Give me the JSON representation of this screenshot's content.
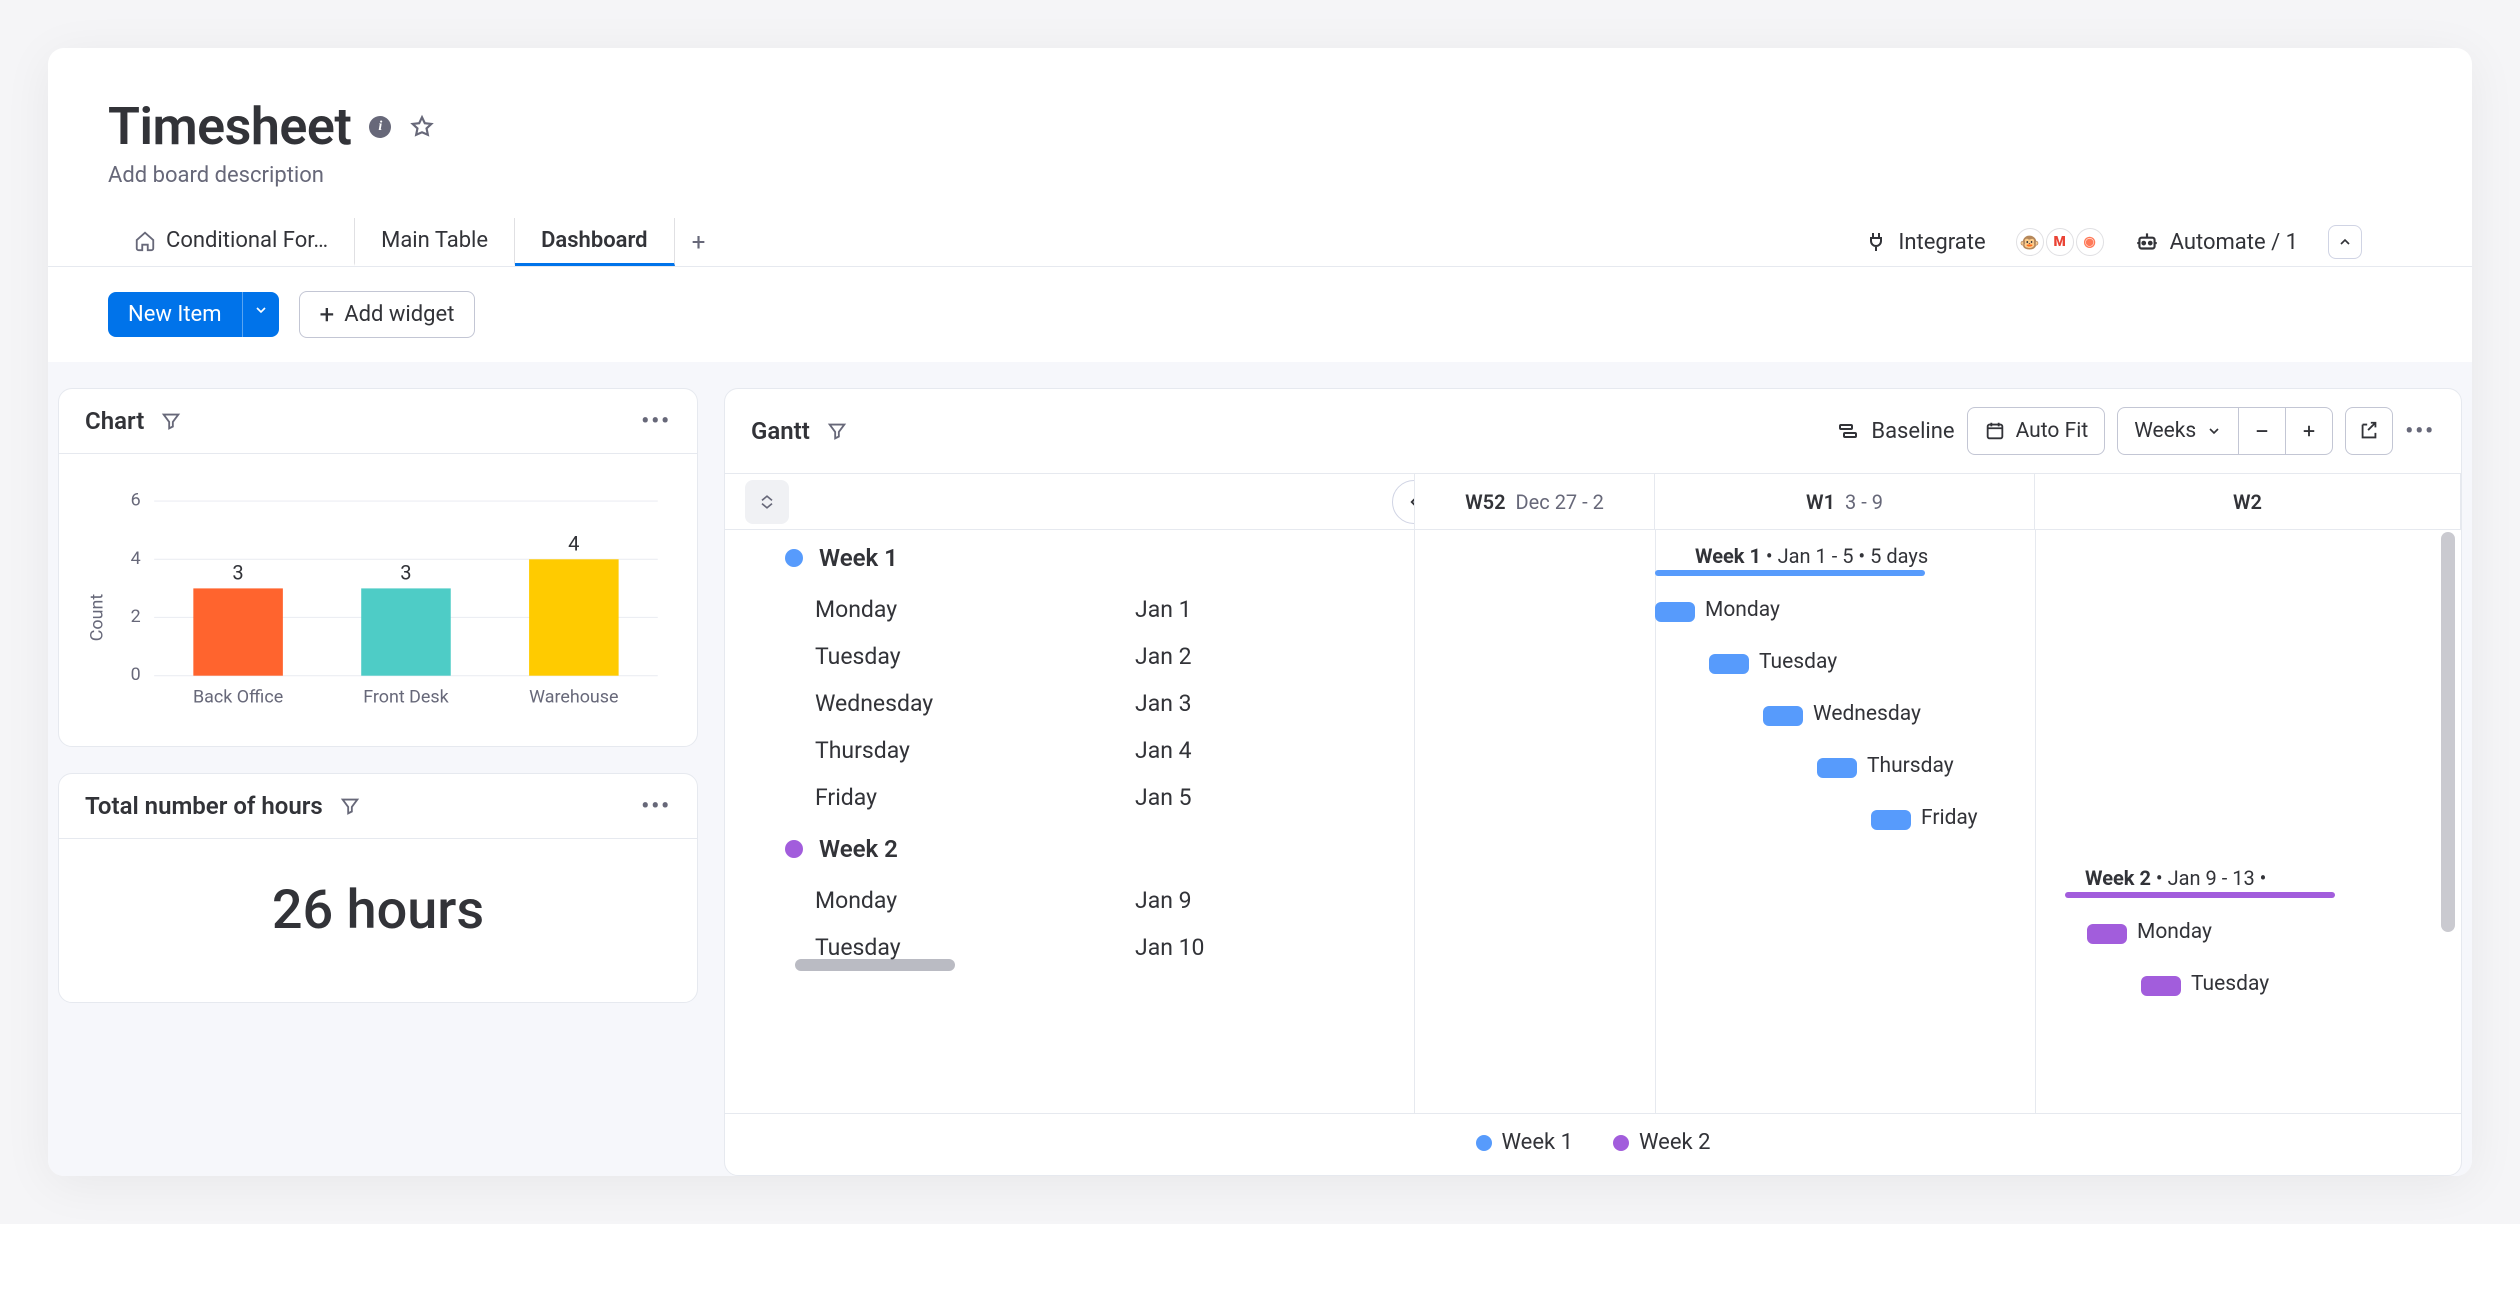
{
  "header": {
    "title": "Timesheet",
    "description": "Add board description"
  },
  "tabs": {
    "items": [
      {
        "label": "Conditional For…",
        "icon": "home-icon"
      },
      {
        "label": "Main Table"
      },
      {
        "label": "Dashboard",
        "active": true
      }
    ],
    "add_tooltip": "Add view"
  },
  "actions": {
    "integrate_label": "Integrate",
    "automate_label": "Automate / 1"
  },
  "toolbar": {
    "new_item_label": "New Item",
    "add_widget_label": "Add widget"
  },
  "chart_widget": {
    "title": "Chart"
  },
  "chart_data": {
    "type": "bar",
    "title": "Chart",
    "xlabel": "",
    "ylabel": "Count",
    "ylim": [
      0,
      6
    ],
    "yticks": [
      0,
      2,
      4,
      6
    ],
    "categories": [
      "Back Office",
      "Front Desk",
      "Warehouse"
    ],
    "values": [
      3,
      3,
      4
    ],
    "colors": [
      "#ff642e",
      "#4eccc6",
      "#ffcb00"
    ]
  },
  "total_widget": {
    "title": "Total number of hours",
    "value": "26 hours"
  },
  "gantt": {
    "title": "Gantt",
    "baseline_label": "Baseline",
    "autofit_label": "Auto Fit",
    "scale_label": "Weeks",
    "timeline": [
      {
        "wk": "W52",
        "range": "Dec 27 - 2"
      },
      {
        "wk": "W1",
        "range": "3 - 9"
      },
      {
        "wk": "W2",
        "range": ""
      }
    ],
    "groups": [
      {
        "name": "Week 1",
        "color": "blue",
        "summary_name": "Week 1",
        "summary_range": "Jan 1 - 5",
        "summary_dur": "5 days",
        "tasks": [
          {
            "name": "Monday",
            "date": "Jan 1"
          },
          {
            "name": "Tuesday",
            "date": "Jan 2"
          },
          {
            "name": "Wednesday",
            "date": "Jan 3"
          },
          {
            "name": "Thursday",
            "date": "Jan 4"
          },
          {
            "name": "Friday",
            "date": "Jan 5"
          }
        ]
      },
      {
        "name": "Week 2",
        "color": "purple",
        "summary_name": "Week 2",
        "summary_range": "Jan 9 - 13",
        "summary_dur": "",
        "tasks": [
          {
            "name": "Monday",
            "date": "Jan 9"
          },
          {
            "name": "Tuesday",
            "date": "Jan 10"
          }
        ]
      }
    ],
    "legend": [
      {
        "label": "Week 1",
        "color": "blue"
      },
      {
        "label": "Week 2",
        "color": "purple"
      }
    ]
  }
}
